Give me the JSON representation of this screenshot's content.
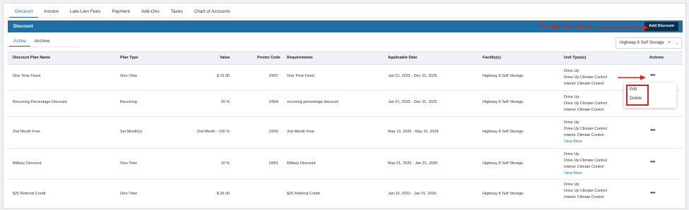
{
  "tabs": [
    "Discount",
    "Invoice",
    "Late-Lien Fees",
    "Payment",
    "Add-Ons",
    "Taxes",
    "Chart of Accounts"
  ],
  "banner": {
    "title": "Discount",
    "add_button": "Add Discount",
    "annotation": "To make a new plan"
  },
  "subtabs": [
    "Active",
    "Archive"
  ],
  "facility_filter": {
    "value": "Highway 8 Self Storage",
    "clear": "×",
    "chevron": "⌄"
  },
  "columns": {
    "name": "Discount Plan Name",
    "type": "Plan Type",
    "value": "Value",
    "promo": "Promo Code",
    "req": "Requirements",
    "date": "Applicable Date",
    "facility": "Facility(s)",
    "units": "Unit Type(s)",
    "actions": "Actions"
  },
  "rows": [
    {
      "name": "One Time Fixed",
      "type": "One-Time",
      "value": "$ 15.00",
      "promo": "D007",
      "req": "One Time Fixed",
      "date": "Jan 01, 2025 - Dec 31, 2025",
      "facility": "Highway 8 Self Storage",
      "u1": "Drive Up",
      "u2": "Drive Up Climate Control",
      "u3": "Interior Climate Control",
      "more": "",
      "actions": "•••"
    },
    {
      "name": "Recurring Percentage Discount",
      "type": "Recurring",
      "value": "25 %",
      "promo": "D004",
      "req": "recurring percentage discount",
      "date": "Jan 01, 2025 - Dec 31, 2025",
      "facility": "Highway 8 Self Storage",
      "u1": "Drive Up",
      "u2": "Drive Up Climate Control",
      "u3": "Interior Climate Control",
      "more": "",
      "actions": "•••"
    },
    {
      "name": "2nd Month Free",
      "type": "Set Month(s)",
      "value": "2nd Month - 100 %",
      "promo": "D002",
      "req": "2nd Month Free",
      "date": "May 19, 2025 - May 31, 2028",
      "facility": "Highway 8 Self Storage",
      "u1": "Drive Up",
      "u2": "Drive Up Climate Control",
      "u3": "Interior Climate Control",
      "more": "View More",
      "actions": "•••"
    },
    {
      "name": "Military Discount",
      "type": "One-Time",
      "value": "10 %",
      "promo": "D001",
      "req": "Military Discount",
      "date": "May 01, 2025 - Jan 31, 2030",
      "facility": "Highway 8 Self Storage",
      "u1": "Drive Up",
      "u2": "Drive Up Climate Control",
      "u3": "Interior Climate Control",
      "more": "View More",
      "actions": "•••"
    },
    {
      "name": "$25 Referral Credit",
      "type": "One-Time",
      "value": "$ 25.00",
      "promo": "",
      "req": "$25 Referral Credit",
      "date": "Jan 25, 2022 - Jan 01, 2030",
      "facility": "Highway 8 Self Storage",
      "u1": "Drive Up",
      "u2": "Drive Up Climate Control",
      "u3": "Interior Climate Control",
      "more": "",
      "actions": "•••"
    }
  ],
  "action_menu": {
    "edit": "Edit",
    "delete": "Delete"
  },
  "colors": {
    "primary": "#1d6fa5",
    "button_dark": "#0f2d4a",
    "annotation_red": "#e0201c"
  }
}
